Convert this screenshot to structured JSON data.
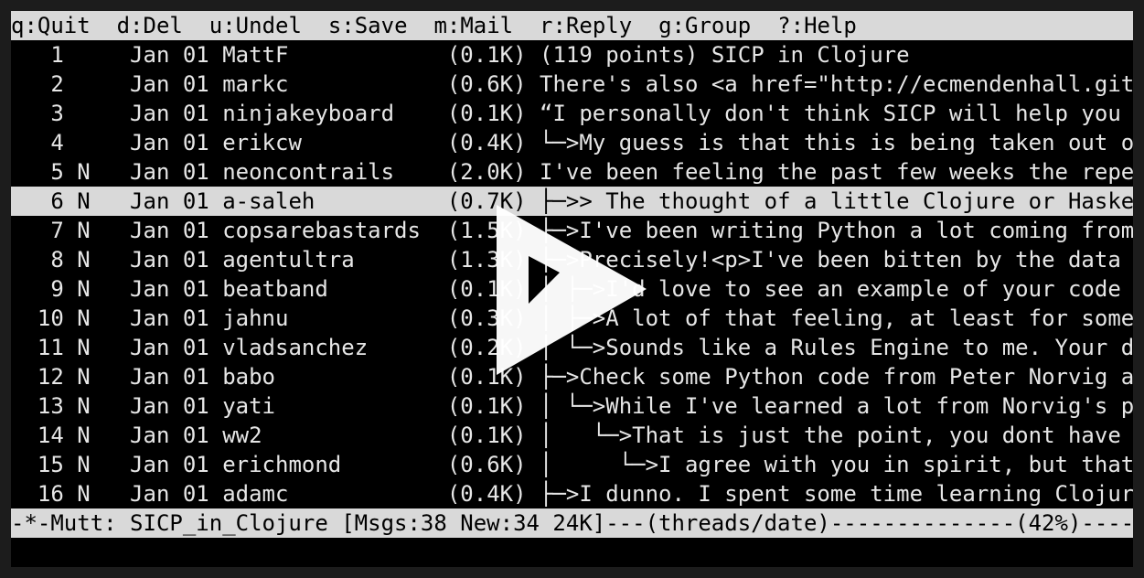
{
  "help_bar": {
    "items": [
      "q:Quit",
      "d:Del",
      "u:Undel",
      "s:Save",
      "m:Mail",
      "r:Reply",
      "g:Group",
      "?:Help"
    ]
  },
  "messages": [
    {
      "num": "1",
      "flag": "",
      "date": "Jan 01",
      "author": "MattF",
      "size": "(0.1K)",
      "subject": "(119 points) SICP in Clojure"
    },
    {
      "num": "2",
      "flag": "",
      "date": "Jan 01",
      "author": "markc",
      "size": "(0.6K)",
      "subject": "There's also <a href=\"http://ecmendenhall.gith"
    },
    {
      "num": "3",
      "flag": "",
      "date": "Jan 01",
      "author": "ninjakeyboard",
      "size": "(0.1K)",
      "subject": "“I personally don't think SICP will help you m"
    },
    {
      "num": "4",
      "flag": "",
      "date": "Jan 01",
      "author": "erikcw",
      "size": "(0.4K)",
      "subject": "└─>My guess is that this is being taken out of"
    },
    {
      "num": "5",
      "flag": "N",
      "date": "Jan 01",
      "author": "neoncontrails",
      "size": "(2.0K)",
      "subject": "I've been feeling the past few weeks the repea"
    },
    {
      "num": "6",
      "flag": "N",
      "date": "Jan 01",
      "author": "a-saleh",
      "size": "(0.7K)",
      "subject": "├─>> The thought of a little Clojure or Haskel"
    },
    {
      "num": "7",
      "flag": "N",
      "date": "Jan 01",
      "author": "copsarebastards",
      "size": "(1.5K)",
      "subject": "├─>I've been writing Python a lot coming from"
    },
    {
      "num": "8",
      "flag": "N",
      "date": "Jan 01",
      "author": "agentultra",
      "size": "(1.3K)",
      "subject": "├─>Precisely!<p>I've been bitten by the data"
    },
    {
      "num": "9",
      "flag": "N",
      "date": "Jan 01",
      "author": "beatband",
      "size": "(0.1K)",
      "subject": "│ ├─>I'd love to see an example of your code"
    },
    {
      "num": "10",
      "flag": "N",
      "date": "Jan 01",
      "author": "jahnu",
      "size": "(0.3K)",
      "subject": "│ ├─>A lot of that feeling, at least for some of"
    },
    {
      "num": "11",
      "flag": "N",
      "date": "Jan 01",
      "author": "vladsanchez",
      "size": "(0.2K)",
      "subject": "│ └─>Sounds like a Rules Engine to me. Your de"
    },
    {
      "num": "12",
      "flag": "N",
      "date": "Jan 01",
      "author": "babo",
      "size": "(0.1K)",
      "subject": "├─>Check some Python code from Peter Norvig an"
    },
    {
      "num": "13",
      "flag": "N",
      "date": "Jan 01",
      "author": "yati",
      "size": "(0.1K)",
      "subject": "│ └─>While I've learned a lot from Norvig's po"
    },
    {
      "num": "14",
      "flag": "N",
      "date": "Jan 01",
      "author": "ww2",
      "size": "(0.1K)",
      "subject": "│   └─>That is just the point, you dont have t"
    },
    {
      "num": "15",
      "flag": "N",
      "date": "Jan 01",
      "author": "erichmond",
      "size": "(0.6K)",
      "subject": "│     └─>I agree with you in spirit, but that'"
    },
    {
      "num": "16",
      "flag": "N",
      "date": "Jan 01",
      "author": "adamc",
      "size": "(0.4K)",
      "subject": "├─>I dunno. I spent some time learning Clojure"
    }
  ],
  "selected_index": 5,
  "status_bar": {
    "text": "-*-Mutt: SICP_in_Clojure [Msgs:38 New:34 24K]---(threads/date)--------------(42%)----"
  },
  "colors": {
    "background": "#000000",
    "foreground": "#e6e6e6",
    "bar_background": "#d9d9d9",
    "bar_foreground": "#000000",
    "overlay": "#ffffff"
  },
  "overlay": {
    "icon": "play-icon"
  }
}
